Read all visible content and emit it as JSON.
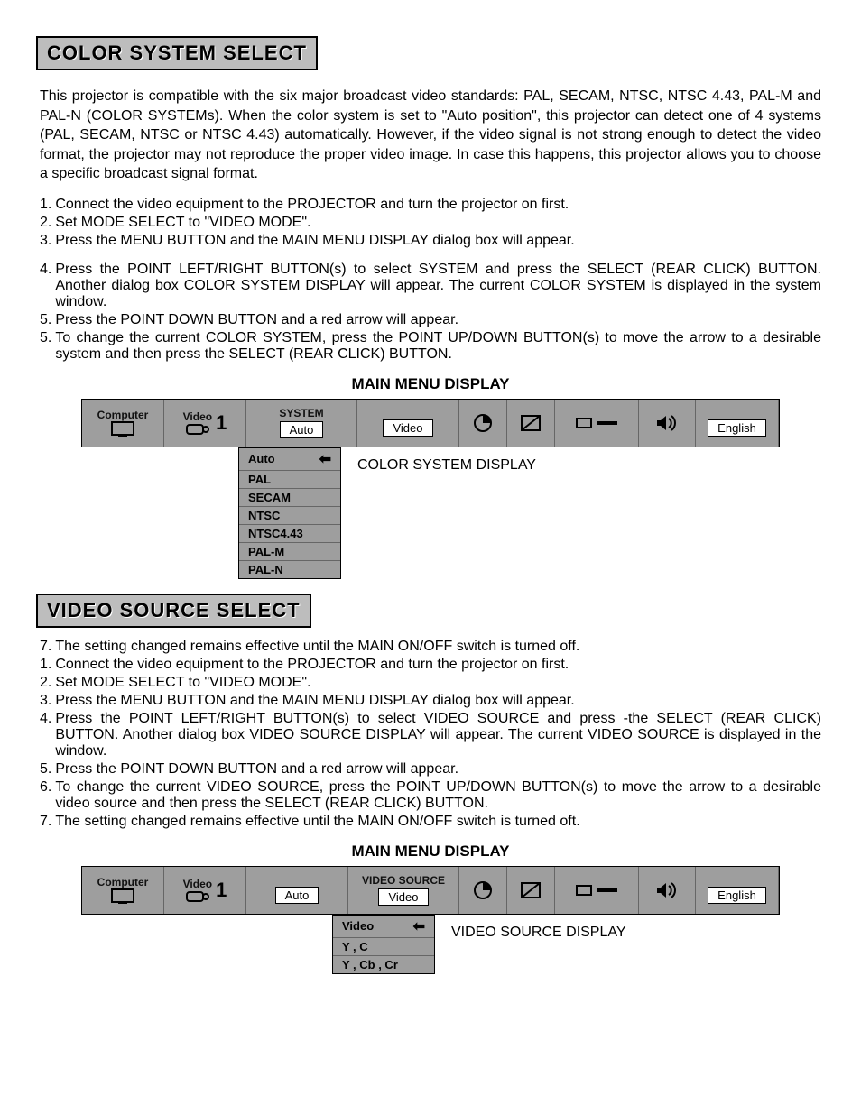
{
  "section1": {
    "title": "COLOR SYSTEM SELECT",
    "intro": "This projector is compatible with the six major broadcast video standards: PAL, SECAM, NTSC, NTSC 4.43, PAL-M and PAL-N (COLOR SYSTEMs). When the color system is set to \"Auto position\", this projector can detect one of 4 systems (PAL, SECAM, NTSC or NTSC 4.43) automatically. However, if the video signal is not strong enough to detect the video format, the projector may not reproduce the proper video image. In case this happens, this projector allows you to choose a specific broadcast signal format.",
    "steps_a": [
      {
        "n": "1.",
        "t": "Connect the video equipment to the PROJECTOR and turn the projector on first."
      },
      {
        "n": "2.",
        "t": "Set MODE SELECT to \"VIDEO MODE\"."
      },
      {
        "n": "3.",
        "t": "Press the MENU BUTTON and the MAIN MENU DISPLAY dialog box will appear."
      }
    ],
    "steps_b": [
      {
        "n": "4.",
        "t": "Press the POINT LEFT/RIGHT BUTTON(s) to select SYSTEM and press the SELECT (REAR CLICK) BUTTON. Another dialog box COLOR SYSTEM DISPLAY will appear. The current COLOR SYSTEM is displayed in the system window."
      },
      {
        "n": "5.",
        "t": "Press the POINT DOWN BUTTON and a red arrow will appear."
      },
      {
        "n": "5.",
        "t": "To change the current COLOR SYSTEM, press the POINT UP/DOWN BUTTON(s) to move the arrow to a desirable system and then press the SELECT (REAR CLICK) BUTTON."
      }
    ]
  },
  "mmd_caption": "MAIN MENU DISPLAY",
  "menu1": {
    "computer_label": "Computer",
    "video_label": "Video",
    "video_num": "1",
    "system_label": "SYSTEM",
    "system_value": "Auto",
    "source_label": "",
    "source_value": "Video",
    "lang_value": "English",
    "dropdown": [
      "Auto",
      "PAL",
      "SECAM",
      "NTSC",
      "NTSC4.43",
      "PAL-M",
      "PAL-N"
    ],
    "drop_caption": "COLOR SYSTEM DISPLAY"
  },
  "section2": {
    "title": "VIDEO SOURCE SELECT",
    "steps": [
      {
        "n": "7.",
        "t": "The setting changed remains effective until the MAIN ON/OFF switch is turned off."
      },
      {
        "n": "1.",
        "t": "Connect the video equipment to the PROJECTOR and turn the projector on first."
      },
      {
        "n": "2.",
        "t": "Set MODE SELECT to \"VIDEO MODE\"."
      },
      {
        "n": "3.",
        "t": "Press the MENU BUTTON and the MAIN MENU DISPLAY dialog box will appear."
      },
      {
        "n": "4.",
        "t": "Press the POINT LEFT/RIGHT BUTTON(s) to select VIDEO SOURCE and press -the SELECT (REAR CLICK) BUTTON. Another dialog box VIDEO SOURCE DISPLAY will appear. The current VIDEO SOURCE is displayed in the window."
      },
      {
        "n": "5.",
        "t": "Press the POINT DOWN BUTTON and a red arrow will appear."
      },
      {
        "n": "6.",
        "t": "To change the current VIDEO SOURCE, press the POINT UP/DOWN BUTTON(s) to move the arrow to a desirable video source and then press the SELECT (REAR CLICK) BUTTON."
      },
      {
        "n": "7.",
        "t": "The setting changed remains effective until the MAIN ON/OFF switch is turned oft."
      }
    ]
  },
  "menu2": {
    "computer_label": "Computer",
    "video_label": "Video",
    "video_num": "1",
    "system_label": "",
    "system_value": "Auto",
    "source_label": "VIDEO SOURCE",
    "source_value": "Video",
    "lang_value": "English",
    "dropdown": [
      "Video",
      "Y , C",
      "Y , Cb , Cr"
    ],
    "drop_caption": "VIDEO SOURCE DISPLAY"
  }
}
